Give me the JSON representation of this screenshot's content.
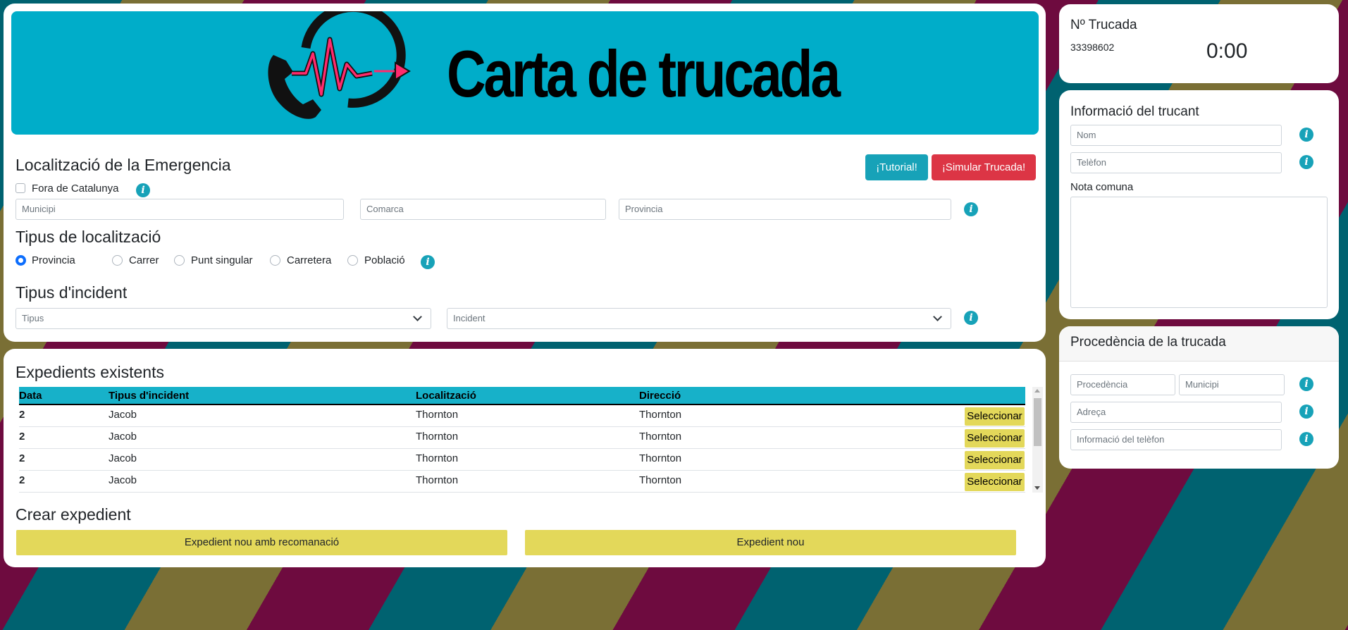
{
  "banner": {
    "title": "Carta de trucada"
  },
  "location": {
    "heading": "Localització de la Emergencia",
    "tutorial_button": "¡Tutorial!",
    "simulate_button": "¡Simular Trucada!",
    "outside_catalonia_label": "Fora de Catalunya",
    "outside_catalonia_checked": false,
    "municipality_placeholder": "Municipi",
    "county_placeholder": "Comarca",
    "province_placeholder": "Provincia"
  },
  "location_type": {
    "heading": "Tipus de localització",
    "options": [
      "Provincia",
      "Carrer",
      "Punt singular",
      "Carretera",
      "Població"
    ],
    "selected": "Provincia"
  },
  "incident_type": {
    "heading": "Tipus d'incident",
    "type_select": "Tipus",
    "incident_select": "Incident"
  },
  "existing_files": {
    "heading": "Expedients existents",
    "columns": [
      "Data",
      "Tipus d'incident",
      "Localització",
      "Direcció"
    ],
    "rows": [
      [
        "2",
        "Jacob",
        "Thornton",
        "Thornton"
      ],
      [
        "2",
        "Jacob",
        "Thornton",
        "Thornton"
      ],
      [
        "2",
        "Jacob",
        "Thornton",
        "Thornton"
      ],
      [
        "2",
        "Jacob",
        "Thornton",
        "Thornton"
      ]
    ],
    "select_label": "Seleccionar"
  },
  "create_file": {
    "heading": "Crear expedient",
    "with_recommendation_button": "Expedient nou amb recomanació",
    "new_button": "Expedient nou"
  },
  "call": {
    "heading": "Nº Trucada",
    "number": "33398602",
    "timer": "0:00"
  },
  "caller": {
    "heading": "Informació del trucant",
    "name_placeholder": "Nom",
    "phone_placeholder": "Telèfon",
    "note_label": "Nota comuna"
  },
  "origin": {
    "heading": "Procedència de la trucada",
    "origin_placeholder": "Procedència",
    "municipality_placeholder": "Municipi",
    "address_placeholder": "Adreça",
    "phone_info_placeholder": "Informació del telèfon"
  },
  "colors": {
    "banner": "#00adc9",
    "info_icon": "#17a2b8",
    "tutorial": "#17a2b8",
    "simulate": "#dc3545",
    "select_button": "#e3d85a",
    "radio_checked": "#0d6efd",
    "logo_pulse": "#ff2a6d"
  }
}
